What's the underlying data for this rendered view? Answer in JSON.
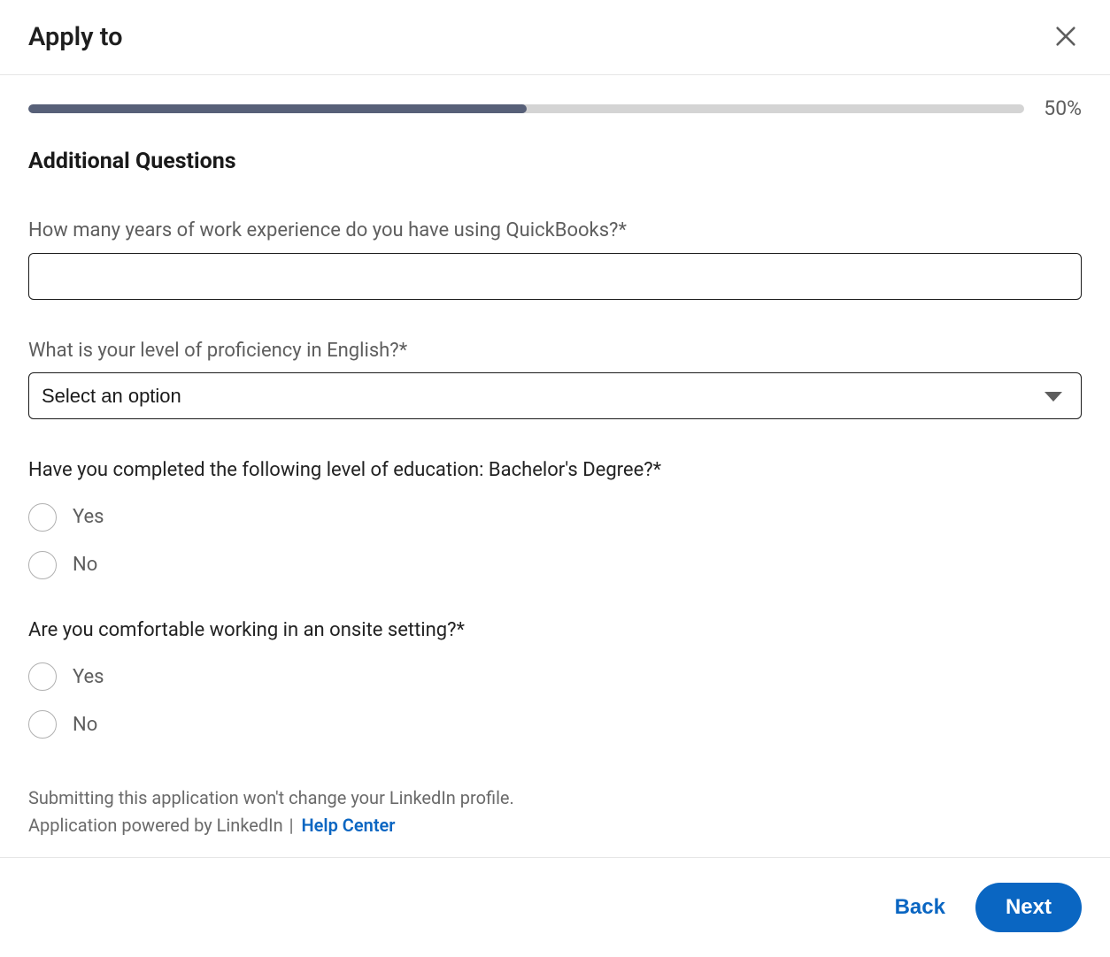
{
  "header": {
    "title": "Apply to"
  },
  "progress": {
    "percent": 50,
    "label": "50%"
  },
  "section": {
    "heading": "Additional Questions"
  },
  "questions": {
    "q1": {
      "label": "How many years of work experience do you have using QuickBooks?*",
      "value": ""
    },
    "q2": {
      "label": "What is your level of proficiency in English?*",
      "placeholder": "Select an option"
    },
    "q3": {
      "label": "Have you completed the following level of education: Bachelor's Degree?*",
      "options": {
        "yes": "Yes",
        "no": "No"
      }
    },
    "q4": {
      "label": "Are you comfortable working in an onsite setting?*",
      "options": {
        "yes": "Yes",
        "no": "No"
      }
    }
  },
  "disclaimer": {
    "line1": "Submitting this application won't change your LinkedIn profile.",
    "powered": "Application powered by LinkedIn",
    "separator": " | ",
    "help": "Help Center"
  },
  "footer": {
    "back": "Back",
    "next": "Next"
  }
}
